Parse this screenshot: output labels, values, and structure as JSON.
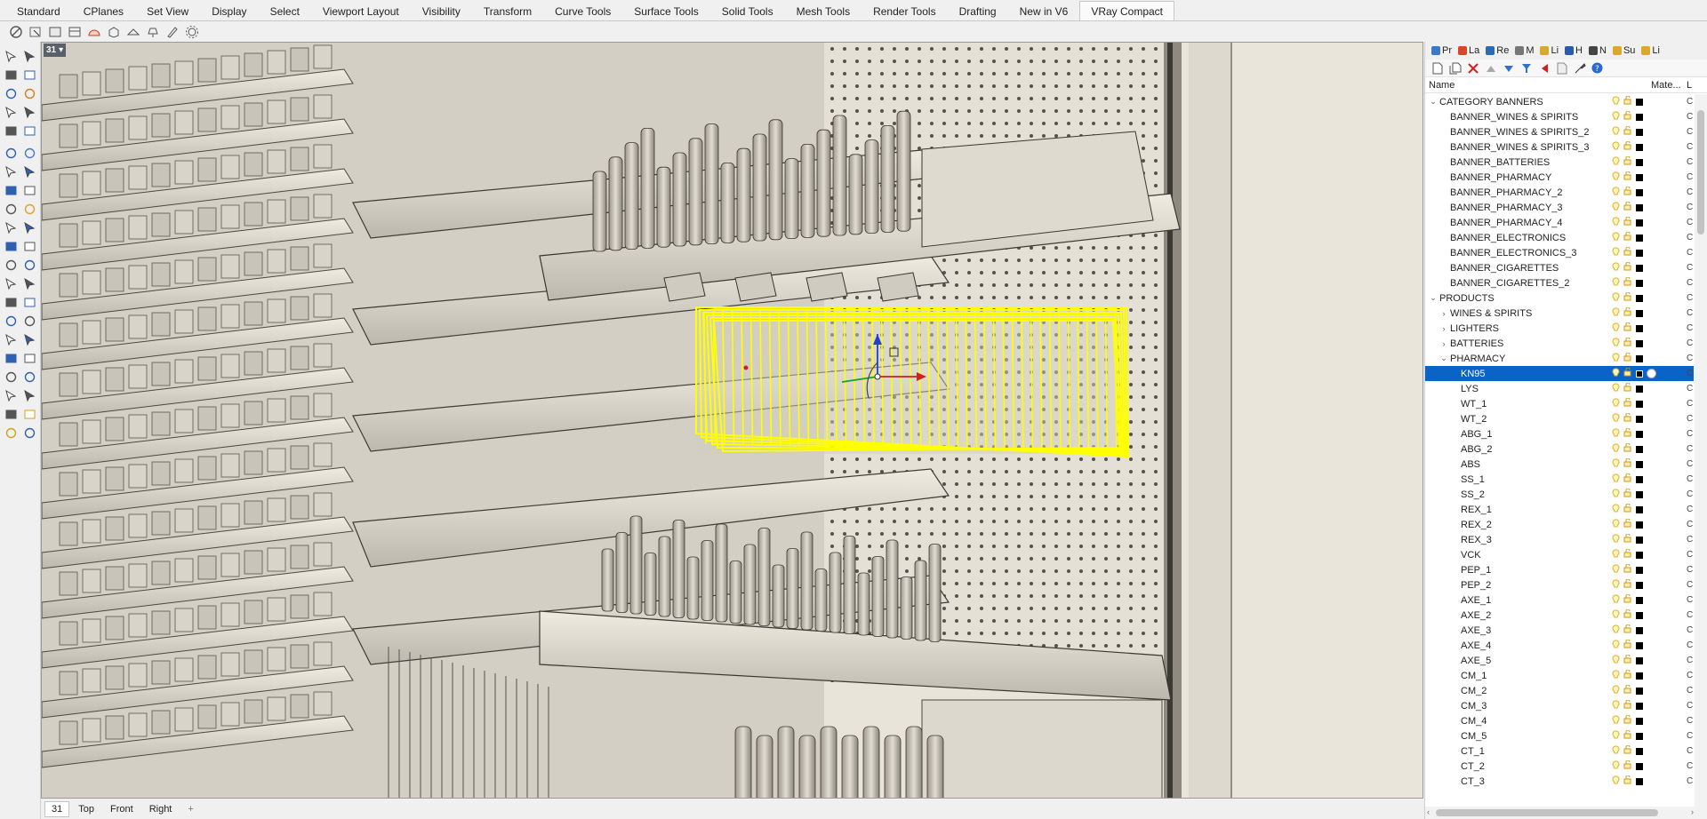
{
  "ribbon_tabs": [
    {
      "label": "Standard",
      "active": false
    },
    {
      "label": "CPlanes",
      "active": false
    },
    {
      "label": "Set View",
      "active": false
    },
    {
      "label": "Display",
      "active": false
    },
    {
      "label": "Select",
      "active": false
    },
    {
      "label": "Viewport Layout",
      "active": false
    },
    {
      "label": "Visibility",
      "active": false
    },
    {
      "label": "Transform",
      "active": false
    },
    {
      "label": "Curve Tools",
      "active": false
    },
    {
      "label": "Surface Tools",
      "active": false
    },
    {
      "label": "Solid Tools",
      "active": false
    },
    {
      "label": "Mesh Tools",
      "active": false
    },
    {
      "label": "Render Tools",
      "active": false
    },
    {
      "label": "Drafting",
      "active": false
    },
    {
      "label": "New in V6",
      "active": false
    },
    {
      "label": "VRay Compact",
      "active": true
    }
  ],
  "viewport": {
    "label": "31",
    "bottom_tabs": [
      {
        "label": "31",
        "active": true
      },
      {
        "label": "Top",
        "active": false
      },
      {
        "label": "Front",
        "active": false
      },
      {
        "label": "Right",
        "active": false
      }
    ],
    "add_tab_icon": "plus-icon"
  },
  "panel": {
    "tabs": [
      {
        "label": "Pr",
        "icon": "properties-icon",
        "color": "#3a78c8"
      },
      {
        "label": "La",
        "icon": "layers-icon",
        "color": "#d04a2a"
      },
      {
        "label": "Re",
        "icon": "rendering-icon",
        "color": "#2a6ab8"
      },
      {
        "label": "M",
        "icon": "materials-icon",
        "color": "#777777"
      },
      {
        "label": "Li",
        "icon": "libraries-icon",
        "color": "#d8a830"
      },
      {
        "label": "H",
        "icon": "help-icon",
        "color": "#2a5aa8"
      },
      {
        "label": "N",
        "icon": "named-views-icon",
        "color": "#444444"
      },
      {
        "label": "Su",
        "icon": "sun-icon",
        "color": "#d8a830"
      },
      {
        "label": "Li",
        "icon": "lights-icon",
        "color": "#d8a830"
      }
    ],
    "columns": {
      "name": "Name",
      "material": "Mate...",
      "linetype": "L"
    },
    "selected_color": "#0a64c8"
  },
  "layers": [
    {
      "name": "CATEGORY BANNERS",
      "depth": 0,
      "expander": "open",
      "lt": "C"
    },
    {
      "name": "BANNER_WINES & SPIRITS",
      "depth": 1,
      "expander": "none",
      "lt": "C"
    },
    {
      "name": "BANNER_WINES & SPIRITS_2",
      "depth": 1,
      "expander": "none",
      "lt": "C"
    },
    {
      "name": "BANNER_WINES & SPIRITS_3",
      "depth": 1,
      "expander": "none",
      "lt": "C"
    },
    {
      "name": "BANNER_BATTERIES",
      "depth": 1,
      "expander": "none",
      "lt": "C"
    },
    {
      "name": "BANNER_PHARMACY",
      "depth": 1,
      "expander": "none",
      "lt": "C"
    },
    {
      "name": "BANNER_PHARMACY_2",
      "depth": 1,
      "expander": "none",
      "lt": "C"
    },
    {
      "name": "BANNER_PHARMACY_3",
      "depth": 1,
      "expander": "none",
      "lt": "C"
    },
    {
      "name": "BANNER_PHARMACY_4",
      "depth": 1,
      "expander": "none",
      "lt": "C"
    },
    {
      "name": "BANNER_ELECTRONICS",
      "depth": 1,
      "expander": "none",
      "lt": "C"
    },
    {
      "name": "BANNER_ELECTRONICS_3",
      "depth": 1,
      "expander": "none",
      "lt": "C"
    },
    {
      "name": "BANNER_CIGARETTES",
      "depth": 1,
      "expander": "none",
      "lt": "C"
    },
    {
      "name": "BANNER_CIGARETTES_2",
      "depth": 1,
      "expander": "none",
      "lt": "C"
    },
    {
      "name": "PRODUCTS",
      "depth": 0,
      "expander": "open",
      "lt": "C"
    },
    {
      "name": "WINES & SPIRITS",
      "depth": 1,
      "expander": "closed",
      "lt": "C"
    },
    {
      "name": "LIGHTERS",
      "depth": 1,
      "expander": "closed",
      "lt": "C"
    },
    {
      "name": "BATTERIES",
      "depth": 1,
      "expander": "closed",
      "lt": "C"
    },
    {
      "name": "PHARMACY",
      "depth": 1,
      "expander": "open",
      "lt": "C"
    },
    {
      "name": "KN95",
      "depth": 2,
      "expander": "none",
      "selected": true,
      "lt": "C"
    },
    {
      "name": "LYS",
      "depth": 2,
      "expander": "none",
      "lt": "C"
    },
    {
      "name": "WT_1",
      "depth": 2,
      "expander": "none",
      "lt": "C"
    },
    {
      "name": "WT_2",
      "depth": 2,
      "expander": "none",
      "lt": "C"
    },
    {
      "name": "ABG_1",
      "depth": 2,
      "expander": "none",
      "lt": "C"
    },
    {
      "name": "ABG_2",
      "depth": 2,
      "expander": "none",
      "lt": "C"
    },
    {
      "name": "ABS",
      "depth": 2,
      "expander": "none",
      "lt": "C"
    },
    {
      "name": "SS_1",
      "depth": 2,
      "expander": "none",
      "lt": "C"
    },
    {
      "name": "SS_2",
      "depth": 2,
      "expander": "none",
      "lt": "C"
    },
    {
      "name": "REX_1",
      "depth": 2,
      "expander": "none",
      "lt": "C"
    },
    {
      "name": "REX_2",
      "depth": 2,
      "expander": "none",
      "lt": "C"
    },
    {
      "name": "REX_3",
      "depth": 2,
      "expander": "none",
      "lt": "C"
    },
    {
      "name": "VCK",
      "depth": 2,
      "expander": "none",
      "lt": "C"
    },
    {
      "name": "PEP_1",
      "depth": 2,
      "expander": "none",
      "lt": "C"
    },
    {
      "name": "PEP_2",
      "depth": 2,
      "expander": "none",
      "lt": "C"
    },
    {
      "name": "AXE_1",
      "depth": 2,
      "expander": "none",
      "lt": "C"
    },
    {
      "name": "AXE_2",
      "depth": 2,
      "expander": "none",
      "lt": "C"
    },
    {
      "name": "AXE_3",
      "depth": 2,
      "expander": "none",
      "lt": "C"
    },
    {
      "name": "AXE_4",
      "depth": 2,
      "expander": "none",
      "lt": "C"
    },
    {
      "name": "AXE_5",
      "depth": 2,
      "expander": "none",
      "lt": "C"
    },
    {
      "name": "CM_1",
      "depth": 2,
      "expander": "none",
      "lt": "C"
    },
    {
      "name": "CM_2",
      "depth": 2,
      "expander": "none",
      "lt": "C"
    },
    {
      "name": "CM_3",
      "depth": 2,
      "expander": "none",
      "lt": "C"
    },
    {
      "name": "CM_4",
      "depth": 2,
      "expander": "none",
      "lt": "C"
    },
    {
      "name": "CM_5",
      "depth": 2,
      "expander": "none",
      "lt": "C"
    },
    {
      "name": "CT_1",
      "depth": 2,
      "expander": "none",
      "lt": "C"
    },
    {
      "name": "CT_2",
      "depth": 2,
      "expander": "none",
      "lt": "C"
    },
    {
      "name": "CT_3",
      "depth": 2,
      "expander": "none",
      "lt": "C"
    }
  ],
  "colors": {
    "selection_highlight": "#ffff00",
    "viewport_background": "#e8e4da",
    "bulb": "#e0b020",
    "lock": "#c89818"
  }
}
